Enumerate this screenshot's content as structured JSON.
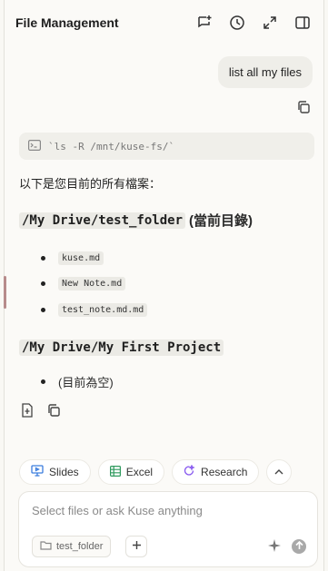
{
  "header": {
    "title": "File Management",
    "icons": [
      "new-chat-icon",
      "history-icon",
      "expand-icon",
      "sidebar-toggle-icon"
    ]
  },
  "user_message": {
    "text": "list all my files"
  },
  "tool_call": {
    "command": "`ls -R /mnt/kuse-fs/`"
  },
  "assistant": {
    "intro": "以下是您目前的所有檔案：",
    "section1": {
      "path": "/My Drive/test_folder",
      "suffix": "(當前目錄)",
      "files": [
        "kuse.md",
        "New Note.md",
        "test_note.md.md"
      ]
    },
    "section2": {
      "path": "/My Drive/My First Project",
      "empty_note": "(目前為空)"
    }
  },
  "chips": {
    "slides": "Slides",
    "excel": "Excel",
    "research": "Research"
  },
  "composer": {
    "placeholder": "Select files or ask Kuse anything",
    "folder": "test_folder"
  },
  "colors": {
    "slides": "#3b7ddd",
    "excel": "#2f9a5e",
    "research": "#8a5cf0",
    "send": "#a9a9a9"
  }
}
